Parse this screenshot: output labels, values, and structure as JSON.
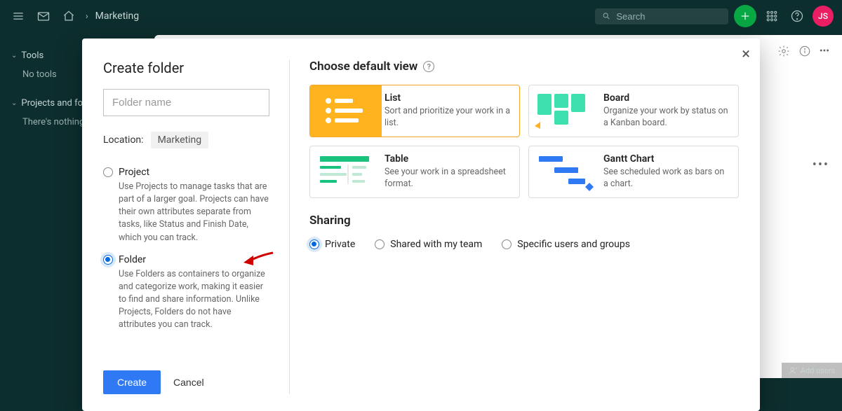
{
  "header": {
    "breadcrumb": "Marketing",
    "search_placeholder": "Search",
    "avatar_initials": "JS"
  },
  "sidebar": {
    "sections": [
      {
        "title": "Tools",
        "empty_text": "No tools"
      },
      {
        "title": "Projects and fol",
        "empty_text": "There's nothing"
      }
    ]
  },
  "modal": {
    "title": "Create folder",
    "name_placeholder": "Folder name",
    "location_label": "Location:",
    "location_value": "Marketing",
    "type_options": [
      {
        "label": "Project",
        "desc": "Use Projects to manage tasks that are part of a larger goal. Projects can have their own attributes separate from tasks, like Status and Finish Date, which you can track."
      },
      {
        "label": "Folder",
        "desc": "Use Folders as containers to organize and categorize work, making it easier to find and share information. Unlike Projects, Folders do not have attributes you can track."
      }
    ],
    "selected_type": 1,
    "create_label": "Create",
    "cancel_label": "Cancel",
    "view_heading": "Choose default view",
    "views": [
      {
        "title": "List",
        "desc": "Sort and prioritize your work in a list."
      },
      {
        "title": "Board",
        "desc": "Organize your work by status on a Kanban board."
      },
      {
        "title": "Table",
        "desc": "See your work in a spreadsheet format."
      },
      {
        "title": "Gantt Chart",
        "desc": "See scheduled work as bars on a chart."
      }
    ],
    "selected_view": 0,
    "sharing_heading": "Sharing",
    "sharing_options": [
      "Private",
      "Shared with my team",
      "Specific users and groups"
    ],
    "selected_sharing": 0
  },
  "footer": {
    "add_users": "Add users"
  }
}
